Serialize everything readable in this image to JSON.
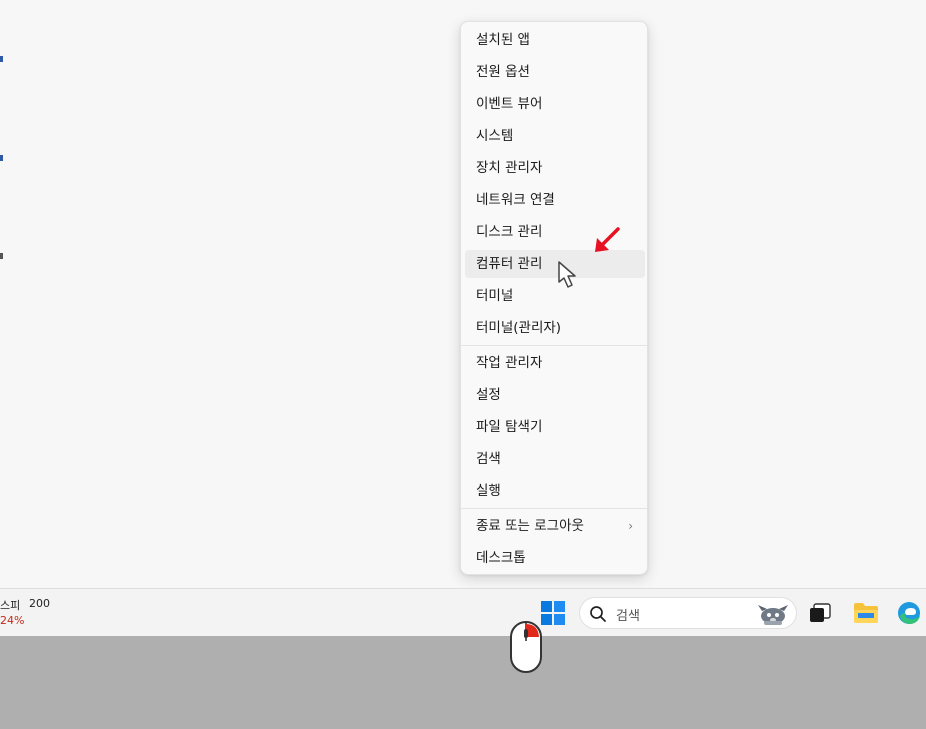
{
  "menu": {
    "items": [
      {
        "label": "설치된 앱"
      },
      {
        "label": "전원 옵션"
      },
      {
        "label": "이벤트 뷰어"
      },
      {
        "label": "시스템"
      },
      {
        "label": "장치 관리자"
      },
      {
        "label": "네트워크 연결"
      },
      {
        "label": "디스크 관리"
      },
      {
        "label": "컴퓨터 관리"
      },
      {
        "label": "터미널"
      },
      {
        "label": "터미널(관리자)"
      },
      {
        "label": "작업 관리자"
      },
      {
        "label": "설정"
      },
      {
        "label": "파일 탐색기"
      },
      {
        "label": "검색"
      },
      {
        "label": "실행"
      },
      {
        "label": "종료 또는 로그아웃"
      },
      {
        "label": "데스크톱"
      }
    ],
    "hovered_item": "컴퓨터 관리",
    "submenu_arrow": "›"
  },
  "taskbar": {
    "stock_name": "스피",
    "stock_value": "200",
    "stock_change": "24%",
    "search_label": "검색"
  },
  "colors": {
    "accent": "#0078d4",
    "stock_down": "#c42b1c",
    "annotation_red": "#e81123"
  },
  "icons": {
    "start": "windows-logo-icon",
    "search": "search-icon",
    "task_view": "task-view-icon",
    "explorer": "folder-icon",
    "edge": "edge-browser-icon",
    "mouse": "mouse-icon",
    "cursor": "hand-cursor-icon",
    "arrow": "red-arrow-icon"
  }
}
